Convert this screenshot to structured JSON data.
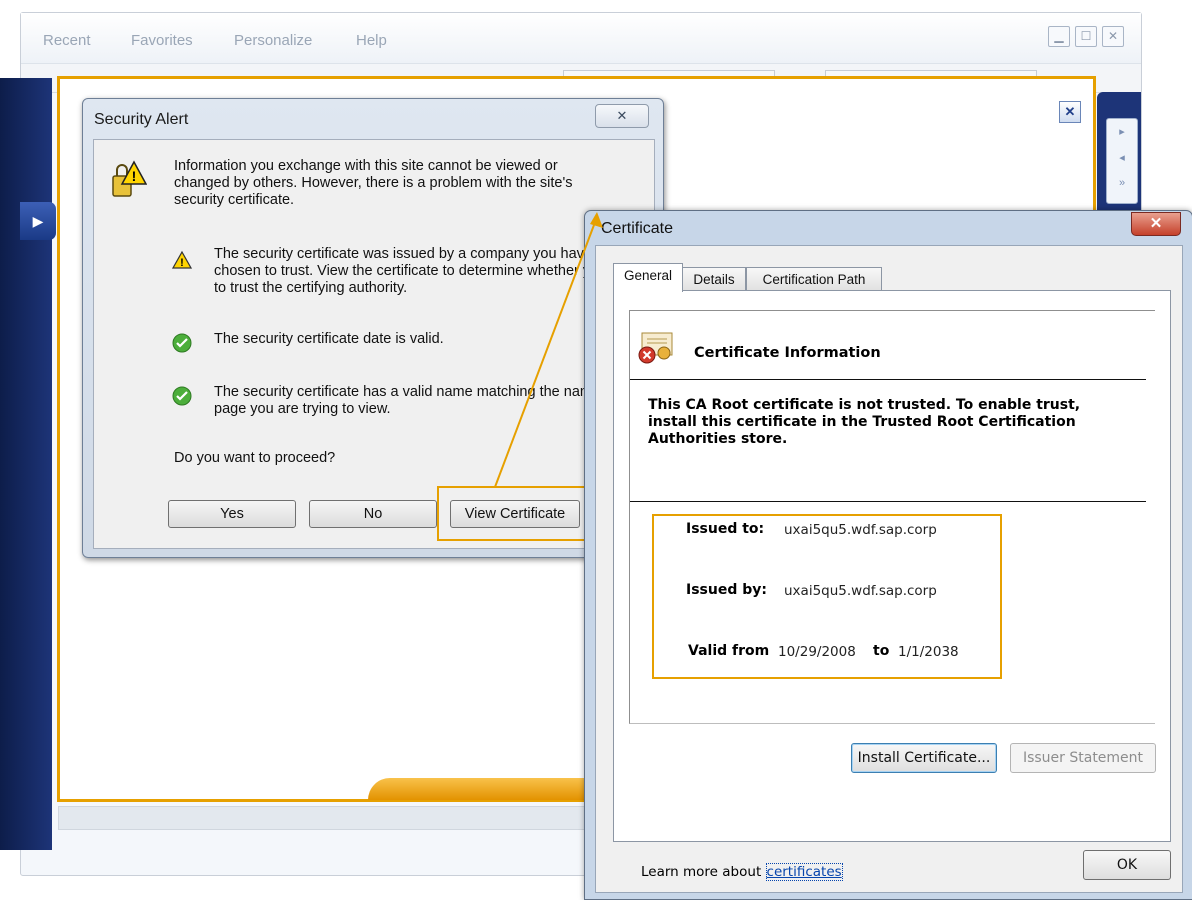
{
  "menu": {
    "items": [
      "Recent",
      "Favorites",
      "Personalize",
      "Help"
    ]
  },
  "security_alert": {
    "title": "Security Alert",
    "intro": "Information you exchange with this site cannot be viewed or changed by others. However, there is a problem with the site's security certificate.",
    "warning": "The security certificate was issued by a company you have not chosen to trust. View the certificate to determine whether you want to trust the certifying authority.",
    "date_ok": "The security certificate date is valid.",
    "name_ok": "The security certificate has a valid name matching the name of the page you are trying to view.",
    "question": "Do you want to proceed?",
    "buttons": {
      "yes": "Yes",
      "no": "No",
      "view": "View Certificate"
    }
  },
  "certificate": {
    "title": "Certificate",
    "tabs": [
      "General",
      "Details",
      "Certification Path"
    ],
    "info_title": "Certificate Information",
    "trust_message": "This CA Root certificate is not trusted. To enable trust, install this certificate in the Trusted Root Certification Authorities store.",
    "issued_to_label": "Issued to:",
    "issued_to": "uxai5qu5.wdf.sap.corp",
    "issued_by_label": "Issued by:",
    "issued_by": "uxai5qu5.wdf.sap.corp",
    "valid_from_label": "Valid from",
    "valid_from": "10/29/2008",
    "to_label": "to",
    "valid_to": "1/1/2038",
    "install_button": "Install Certificate...",
    "issuer_button": "Issuer Statement",
    "learn_more": "Learn more about",
    "link": "certificates",
    "ok_button": "OK"
  },
  "colors": {
    "highlight": "#e6a000",
    "navy": "#1d3478"
  }
}
